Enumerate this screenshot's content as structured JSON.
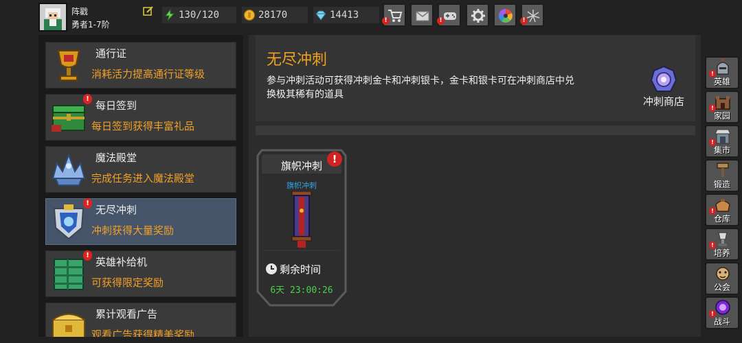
{
  "player": {
    "name": "阵戳",
    "rank": "勇者1-7阶"
  },
  "resources": {
    "energy": "130/120",
    "gold": "28170",
    "gems": "14413"
  },
  "top_buttons": [
    {
      "name": "shop-cart-icon",
      "alert": "!"
    },
    {
      "name": "mail-icon",
      "alert": ""
    },
    {
      "name": "gamepad-icon",
      "alert": "!"
    },
    {
      "name": "settings-gear-icon",
      "alert": ""
    },
    {
      "name": "color-wheel-icon",
      "alert": ""
    },
    {
      "name": "firework-icon",
      "alert": "!"
    }
  ],
  "menu": [
    {
      "title": "通行证",
      "desc": "消耗活力提高通行证等级",
      "badge": ""
    },
    {
      "title": "每日签到",
      "desc": "每日签到获得丰富礼品",
      "badge": "!"
    },
    {
      "title": "魔法殿堂",
      "desc": "完成任务进入魔法殿堂",
      "badge": ""
    },
    {
      "title": "无尽冲刺",
      "desc": "冲刺获得大量奖励",
      "badge": "!"
    },
    {
      "title": "英雄补给机",
      "desc": "可获得限定奖励",
      "badge": "!"
    },
    {
      "title": "累计观看广告",
      "desc": "观看广告获得精美奖励",
      "badge": ""
    }
  ],
  "main": {
    "title": "无尽冲刺",
    "description": "参与冲刺活动可获得冲刺金卡和冲刺银卡，金卡和银卡可在冲刺商店中兑换极其稀有的道具",
    "shop_label": "冲刺商店",
    "card": {
      "title": "旗帜冲刺",
      "subtitle": "旗帜冲刺",
      "alert": "!",
      "remaining_label": "剩余时间",
      "remaining_time": "6天 23:00:26"
    }
  },
  "right_nav": [
    {
      "label": "英雄",
      "alert": "!"
    },
    {
      "label": "家园",
      "alert": "!"
    },
    {
      "label": "集市",
      "alert": "!"
    },
    {
      "label": "锻造",
      "alert": ""
    },
    {
      "label": "仓库",
      "alert": "!"
    },
    {
      "label": "培养",
      "alert": "!"
    },
    {
      "label": "公会",
      "alert": ""
    },
    {
      "label": "战斗",
      "alert": "!"
    }
  ],
  "colors": {
    "accent_orange": "#f0a020",
    "active_tab": "#455468",
    "timer_green": "#4cd04c",
    "subtitle_blue": "#35a3e0",
    "alert_red": "#d02323"
  }
}
